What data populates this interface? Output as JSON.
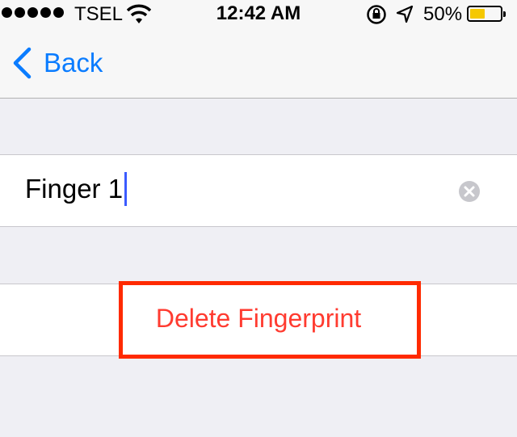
{
  "status_bar": {
    "carrier": "TSEL",
    "time": "12:42 AM",
    "battery_percent": "50%",
    "battery_color": "#f5c800",
    "icons": [
      "signal-dots-icon",
      "wifi-icon",
      "rotation-lock-icon",
      "location-arrow-icon",
      "battery-icon"
    ]
  },
  "nav": {
    "back_label": "Back",
    "accent_color": "#0a7cff"
  },
  "fingerprint": {
    "name_value": "Finger 1",
    "clear_icon": "clear-circle-icon"
  },
  "actions": {
    "delete_label": "Delete Fingerprint",
    "delete_color": "#ff3b30",
    "highlight_color": "#ff2a00"
  }
}
